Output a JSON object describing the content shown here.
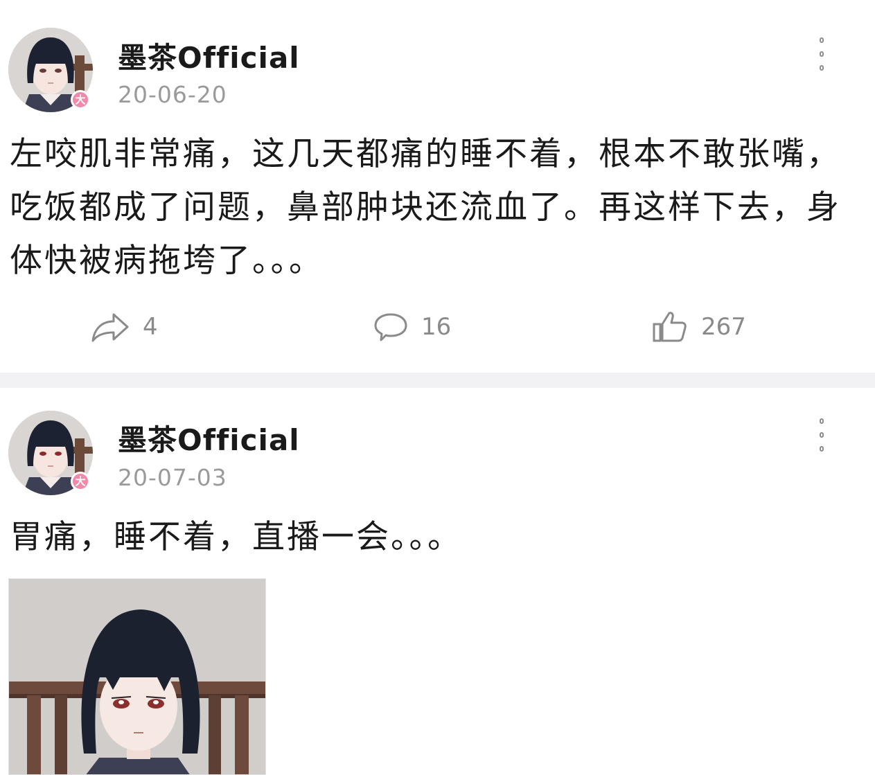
{
  "posts": [
    {
      "username": "墨茶Official",
      "date": "20-06-20",
      "badge": "大",
      "text": "左咬肌非常痛，这几天都痛的睡不着，根本不敢张嘴，吃饭都成了问题，鼻部肿块还流血了。再这样下去，身体快被病拖垮了。。。",
      "repost_count": "4",
      "comment_count": "16",
      "like_count": "267"
    },
    {
      "username": "墨茶Official",
      "date": "20-07-03",
      "badge": "大",
      "text": "胃痛，睡不着，直播一会。。。"
    }
  ],
  "icons": {
    "repost": "repost-arrow-icon",
    "comment": "comment-bubble-icon",
    "like": "thumbs-up-icon",
    "more": "vertical-dots-icon"
  },
  "colors": {
    "badge": "#f08aa8",
    "meta_text": "#9a9a9a",
    "body_text": "#1a1a1a",
    "separator": "#f2f2f4"
  }
}
